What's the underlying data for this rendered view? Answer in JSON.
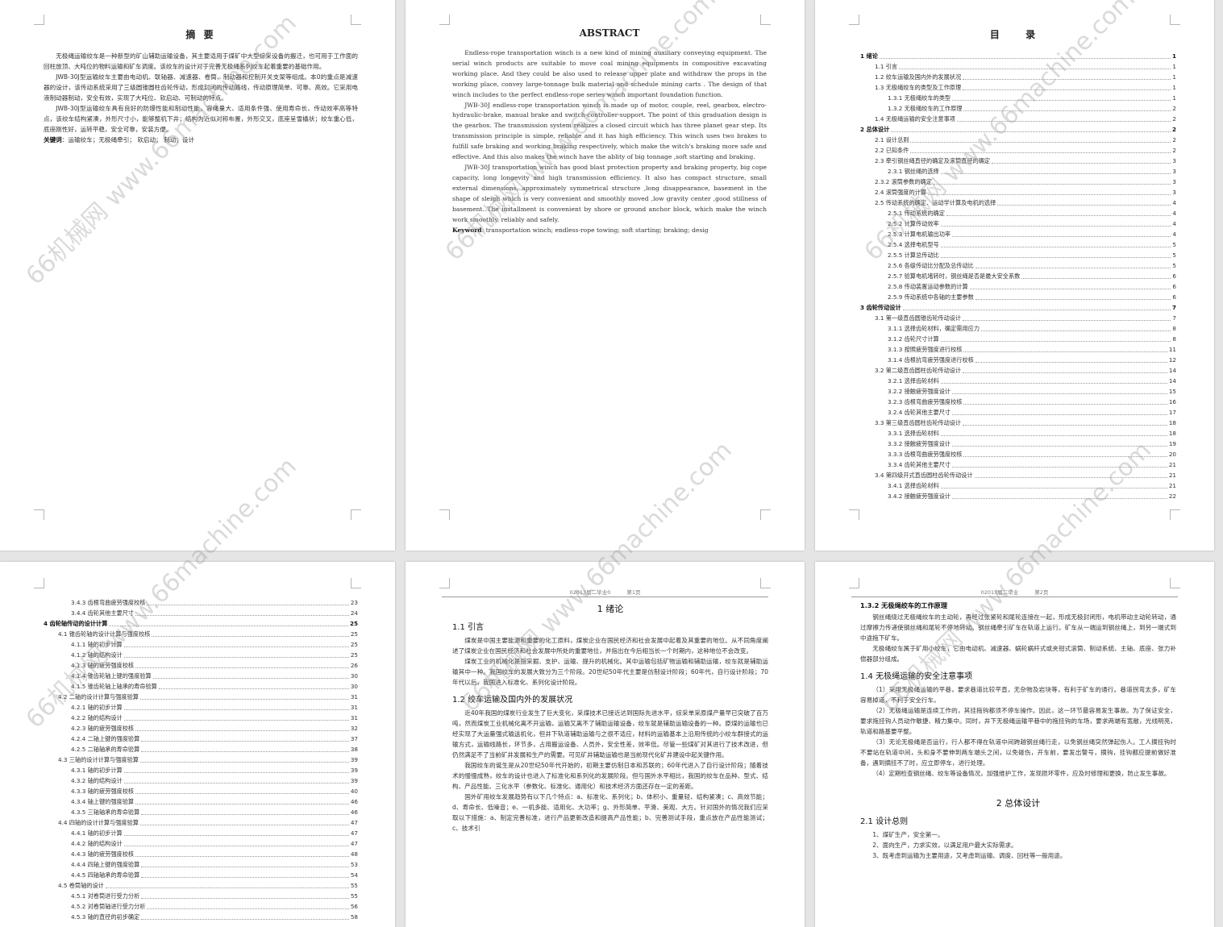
{
  "watermark": "66机械网 www.66machine.com",
  "pages": {
    "abstract_cn": {
      "title": "摘 要",
      "paragraphs": [
        "无极绳运输绞车是一种新型的矿山辅助运输设备，其主要适用于煤矿中大型综采设备的搬迁，也可用于工作面的回柱放顶、大吨位的物料运输和矿车调度。该绞车的设计对于完善无极绳系列绞车起着重要的基础作用。",
        "JWB-30J型运输绞车主要由电动机、联轴器、减速器、卷筒、制动器和控制开关支架等组成。本0的重点是减速器的设计，该传动系统采用了三级圆锥圆柱齿轮传动，形成封闭的传动路线，传动原理简单、可靠、高效。它采用电液制动器制动，安全有效，实现了大吨位、软启动、可制动的特点。",
        "JWB-30J型运输绞车具有良好的防爆性能和制动性能，容绳量大、适用条件强、使用寿命长、传动效率高等特点，该绞车结构紧凑，外形尺寸小，能够整机下井；结构为近似对称布置，外形交叉，底座呈雪橇状；绞车重心低，底座刚性好，运转平稳，安全可靠，安装方便。"
      ],
      "keywords_label": "关键词",
      "keywords": "：运输绞车；无极绳牵引； 软启动； 制动；设计"
    },
    "abstract_en": {
      "title": "ABSTRACT",
      "paragraphs": [
        "Endless-rope transportation winch is a new kind of mining auxiliary conveying equipment. The serial winch products are suitable to move coal mining equipments in compositive excavating working place. And they could be also used to release upper plate and withdraw the props in the working place, convey large-tonnage bulk material and schedule mining carts . The design of that winch includes to the perfect endless-rope series winch important foundation function.",
        "JWB-30J endless-rope transportation winch is made up of motor, couple, reel, gearbox, electro-hydraulic-brake, manual brake and switch-controller-support. The point of this graduation design is the gearbox. The transmission system realizes a closed circuit which has three planet gear step. Its transmission principle is simple, reliable and it has high efficiency. This winch uses two brakes to fulfill safe braking and working braking respectively, which make the witch's braking more safe and effective. And this also makes the winch have the ablity of big tonnage ,soft starting and braking.",
        "JWB-30J transportation winch has good blast protection property and braking property, big cope capacity, long longevity and high transmission efficiency. It also has compact structure, small external dimensions, approximately symmetrical structure ,long disappearance, basement in the shape of sleigh which is very convenient and smoothly moved ,low gravity center ,good stillness of basement. The installment is convenient by shore or ground anchor block, which make the winch work smoothly, reliably and safely."
      ],
      "keywords_label": "Keyword",
      "keywords": ": transportation winch; endless-rope towing; soft starting; braking; desig"
    },
    "toc1": {
      "title": "目 录",
      "entries": [
        {
          "level": 1,
          "text": "1 绪论",
          "page": "1"
        },
        {
          "level": 2,
          "text": "1.1 引言",
          "page": "1"
        },
        {
          "level": 2,
          "text": "1.2 绞车运输及国内外的发展状况",
          "page": "1"
        },
        {
          "level": 2,
          "text": "1.3 无极绳绞车的类型及工作原理",
          "page": "1"
        },
        {
          "level": 3,
          "text": "1.3.1 无极绳绞车的类型",
          "page": "1"
        },
        {
          "level": 3,
          "text": "1.3.2 无极绳绞车的工作原理",
          "page": "2"
        },
        {
          "level": 2,
          "text": "1.4 无极绳运输的安全注意事项",
          "page": "2"
        },
        {
          "level": 1,
          "text": "2 总体设计",
          "page": "2"
        },
        {
          "level": 2,
          "text": "2.1 设计总则",
          "page": "2"
        },
        {
          "level": 2,
          "text": "2.2 已知条件",
          "page": "2"
        },
        {
          "level": 2,
          "text": "2.3 牵引钢丝绳直径的确定及滚筒直径的确定",
          "page": "3"
        },
        {
          "level": 3,
          "text": "2.3.1 钢丝绳的选择",
          "page": "3"
        },
        {
          "level": 2,
          "text": "2.3.2 滚筒参数的确定",
          "page": "3"
        },
        {
          "level": 2,
          "text": "2.4 滚筒强度的计算",
          "page": "3"
        },
        {
          "level": 2,
          "text": "2.5 传动系统的确定、运动学计算及电机的选择",
          "page": "4"
        },
        {
          "level": 3,
          "text": "2.5.1 传动系统的确定",
          "page": "4"
        },
        {
          "level": 3,
          "text": "2.5.2 计算传动效率",
          "page": "4"
        },
        {
          "level": 3,
          "text": "2.5.3 计算电机输出功率",
          "page": "4"
        },
        {
          "level": 3,
          "text": "2.5.4 选择电机型号",
          "page": "5"
        },
        {
          "level": 3,
          "text": "2.5.5 计算总传动比",
          "page": "5"
        },
        {
          "level": 3,
          "text": "2.5.6 各级传动比分配及总传动比",
          "page": "5"
        },
        {
          "level": 3,
          "text": "2.5.7 验算电机堵转时，钢丝绳是否是最大安全系数",
          "page": "6"
        },
        {
          "level": 3,
          "text": "2.5.8 传动装置运动参数的计算",
          "page": "6"
        },
        {
          "level": 3,
          "text": "2.5.9 传动系统中各轴的主要参数",
          "page": "6"
        },
        {
          "level": 1,
          "text": "3 齿轮传动设计",
          "page": "7"
        },
        {
          "level": 2,
          "text": "3.1 第一级直齿圆锥齿轮传动设计",
          "page": "7"
        },
        {
          "level": 3,
          "text": "3.1.1 选择齿轮材料，确定需用应力",
          "page": "8"
        },
        {
          "level": 3,
          "text": "3.1.2 齿轮尺寸计算",
          "page": "8"
        },
        {
          "level": 3,
          "text": "3.1.3 按照疲劳强度进行校核",
          "page": "11"
        },
        {
          "level": 3,
          "text": "3.1.4 齿根抗弯疲劳强度进行校核",
          "page": "12"
        },
        {
          "level": 2,
          "text": "3.2 第二级直齿圆柱齿轮传动设计",
          "page": "14"
        },
        {
          "level": 3,
          "text": "3.2.1 选择齿轮材料",
          "page": "14"
        },
        {
          "level": 3,
          "text": "3.2.2 接触疲劳强度设计",
          "page": "15"
        },
        {
          "level": 3,
          "text": "3.2.3 齿根弯曲疲劳强度校核",
          "page": "16"
        },
        {
          "level": 3,
          "text": "3.2.4 齿轮其他主要尺寸",
          "page": "17"
        },
        {
          "level": 2,
          "text": "3.3 第三级直齿圆柱齿轮传动设计",
          "page": "18"
        },
        {
          "level": 3,
          "text": "3.3.1 选择齿轮材料",
          "page": "18"
        },
        {
          "level": 3,
          "text": "3.3.2 接触疲劳强度设计",
          "page": "19"
        },
        {
          "level": 3,
          "text": "3.3.3 齿根弯曲疲劳强度校核",
          "page": "20"
        },
        {
          "level": 3,
          "text": "3.3.4 齿轮其他主要尺寸",
          "page": "21"
        },
        {
          "level": 2,
          "text": "3.4 第四级开式直齿圆柱齿轮传动设计",
          "page": "21"
        },
        {
          "level": 3,
          "text": "3.4.1 选择齿轮材料",
          "page": "21"
        },
        {
          "level": 3,
          "text": "3.4.2 接触疲劳强度设计",
          "page": "22"
        }
      ]
    },
    "toc2": {
      "entries": [
        {
          "level": 3,
          "text": "3.4.3 齿根弯曲疲劳强度校核",
          "page": "23"
        },
        {
          "level": 3,
          "text": "3.4.4 齿轮其他主要尺寸",
          "page": "24"
        },
        {
          "level": 1,
          "text": "4 齿轮轴传动的设计计算",
          "page": "25"
        },
        {
          "level": 2,
          "text": "4.1 锥齿轮轴的设计计算与强度校核",
          "page": "25"
        },
        {
          "level": 3,
          "text": "4.1.1 轴的初步计算",
          "page": "25"
        },
        {
          "level": 3,
          "text": "4.1.2 轴的结构设计",
          "page": "25"
        },
        {
          "level": 3,
          "text": "4.1.3 轴的疲劳强度校核",
          "page": "26"
        },
        {
          "level": 3,
          "text": "4.1.4 锥齿轮轴上键的强度验算",
          "page": "30"
        },
        {
          "level": 3,
          "text": "4.1.5 锥齿轮轴上轴承的寿命验算",
          "page": "30"
        },
        {
          "level": 2,
          "text": "4.2 二轴的设计计算与强度验算",
          "page": "31"
        },
        {
          "level": 3,
          "text": "4.2.1 轴的初步计算",
          "page": "31"
        },
        {
          "level": 3,
          "text": "4.2.2 轴的结构设计",
          "page": "31"
        },
        {
          "level": 3,
          "text": "4.2.3 轴的疲劳强度校核",
          "page": "32"
        },
        {
          "level": 3,
          "text": "4.2.4 二轴上键的强度验算",
          "page": "37"
        },
        {
          "level": 3,
          "text": "4.2.5 二轴轴承的寿命验算",
          "page": "38"
        },
        {
          "level": 2,
          "text": "4.3 三轴的设计计算与强度验算",
          "page": "39"
        },
        {
          "level": 3,
          "text": "4.3.1 轴的初步计算",
          "page": "39"
        },
        {
          "level": 3,
          "text": "4.3.2 轴的结构设计",
          "page": "39"
        },
        {
          "level": 3,
          "text": "4.3.3 轴的疲劳强度校核",
          "page": "40"
        },
        {
          "level": 3,
          "text": "4.3.4 轴上键的强度验算",
          "page": "46"
        },
        {
          "level": 3,
          "text": "4.3.5 三轴轴承的寿命验算",
          "page": "46"
        },
        {
          "level": 2,
          "text": "4.4 四轴的设计计算与强度验算",
          "page": "47"
        },
        {
          "level": 3,
          "text": "4.4.1 轴的初步计算",
          "page": "47"
        },
        {
          "level": 3,
          "text": "4.4.2 轴的结构设计",
          "page": "47"
        },
        {
          "level": 3,
          "text": "4.4.3 轴的疲劳强度校核",
          "page": "48"
        },
        {
          "level": 3,
          "text": "4.4.4 四轴上键的强度验算",
          "page": "53"
        },
        {
          "level": 3,
          "text": "4.4.5 四轴轴承的寿命验算",
          "page": "54"
        },
        {
          "level": 2,
          "text": "4.5 卷筒轴的设计",
          "page": "55"
        },
        {
          "level": 3,
          "text": "4.5.1 对卷筒进行受力分析",
          "page": "55"
        },
        {
          "level": 3,
          "text": "4.5.2 对卷筒轴进行受力分析",
          "page": "56"
        },
        {
          "level": 3,
          "text": "4.5.3 轴的直径的初步确定",
          "page": "58"
        }
      ]
    },
    "ch1": {
      "header_left": "02013届二毕业0",
      "header_right": "第1页",
      "chapter_title": "1 绪论",
      "s1_title": "1.1 引言",
      "s1_paragraphs": [
        "煤炭是中国主要能源和重要的化工原料，煤炭企业在国民经济和社会发展中起着及其重要的地位。从不同角度阐述了煤炭企业在国民经济和社会发展中所处的重要地位，并指出在今后相当长一个时期内，这种地位不会改变。",
        "煤炭工业的机械化是指采掘、支护、运输、提升的机械化。其中运输包括矿物运输和辅助运输，绞车就是辅助运输其中一种。我国绞车的发展大致分为三个阶段。20世纪50年代主要是仿制设计阶段；60年代，自行设计阶段；70年代以后，我国进入标准化、系列化设计阶段。"
      ],
      "s2_title": "1.2 绞车运输及国内外的发展状况",
      "s2_paragraphs": [
        "近40年我国的煤炭行业发生了巨大变化，采煤技术已接近达到国际先进水平，综采单采原煤产量早已突破了百万吨，然而煤炭工业机械化离不开运输，运输又离不了辅助运输设备，绞车就是辅助运输设备的一种。原煤的运输也已经实现了大运量强式输送机化，但井下轨道辅助运输与之很不适应，材料的运输基本上沿用传统的小绞车群接式的运输方式，运输线路长，环节多，占用搬运设备、人员外，安全性差，效率低。尽管一些煤矿对其进行了技术改进，但仍然满足不了当前矿井发展和生产的需要。可见矿井辅助运输也是当前现代化矿井建设中起关键作用。",
        "我国绞车的诞生是从20世纪50年代开始的，初期主要仿制日本和苏联的；60年代进入了自行设计阶段；随着技术的慢慢成熟，绞车的设计也进入了标准化和系列化的发展阶段。但与国外水平相比，我国的绞车在品种、型式、结构、产品性能、三化水平（参数化、标准化、通用化）和技术经济方面还存在一定的差距。",
        "国外矿用绞车发展趋势有以下几个特点：a、标准化、系列化；b、体积小、重量轻、结构紧凑；c、高效节能；d、寿命长、低噪音；e、一机多能、适用化、大功率；g、外形简单、平滑、美观、大方。针对国外的情况我们应采取以下措施：a、制定完善标准，进行产品更新改造和提高产品性能；b、完善测试手段，重点放在产品性能测试；c、技术引"
      ]
    },
    "ch2": {
      "header_left": "02013届二毕业",
      "header_right": "第2页",
      "s132_title": "1.3.2 无极绳绞车的工作原理",
      "s132_paragraphs": [
        "钢丝绳绕过无极绳绞车的主动轮，再经过张紧轮和尾轮连接在一起，形成无极封闭形，电机带动主动轮转动，通过摩擦力传递使钢丝绳和尾轮不停地转动。钢丝绳牵引矿车在轨道上运行。矿车从一端运到钢丝绳上，到另一端式到中途拖下矿车。",
        "无极绳绞车属于矿用小绞车，它由电动机、减速器、蜗轮蜗杆式或夹钳式滚筒、制动系统、主轴、底座、张力补偿器部分组成。"
      ],
      "s14_title": "1.4 无极绳运输的安全注意事项",
      "s14_paragraphs": [
        "（1）采用无极绳运输的平巷，要求巷道比较平直，无杂物及岩块等，有利于矿车的通行。巷道拐弯太多，矿车容易掉道，不利于安全行车。",
        "（2）无极绳运输是连续工作的，其挂拖钩都须不停车操作。因此，这一环节最容易发生事故。为了保证安全，要求拖挂钩人员动作敏捷、精力集中。同时，井下无极绳运输平巷中的拖挂钩的车场，要求两端有宽敞，光线明亮，轨道和路基要平整。",
        "（3）无论无极绳是否运行，行人都不得在轨道中间跨越钢丝绳行走，以免钢丝绳突然弹起伤人。工人摘挂钩时不要站在轨道中间，头和身不要伸到两车端头之间，以免碰伤，开车前，要发出警号，摘钩，挂钩都应提前做好准备，遇到摘挂不了时，应立即停车，进行处理。",
        "（4）定期检查钢丝绳、绞车等设备情况，加强维护工作，发现损坏零件，应及时修理和更换，防止发生事故。"
      ],
      "chapter2_title": "2 总体设计",
      "s21_title": "2.1 设计总则",
      "s21_items": [
        "1、煤矿生产，安全第一。",
        "2、面向生产，力求实效，以满足用户最大实际需求。",
        "3、既考虑到运输为主要用途，又考虑到运输、调度、回柱等一般用途。"
      ]
    }
  }
}
